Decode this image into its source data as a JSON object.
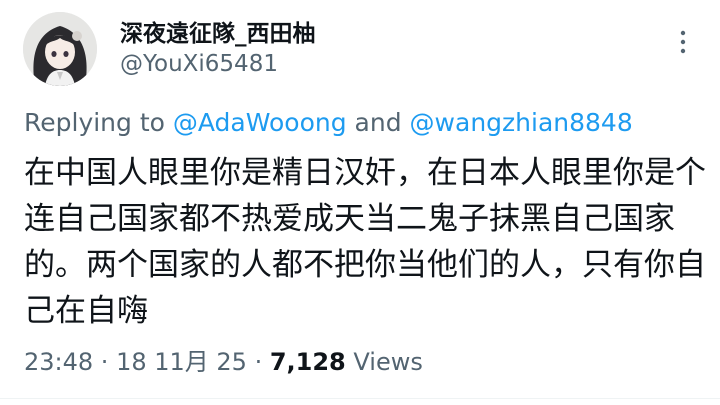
{
  "author": {
    "display_name": "深夜遠征隊_西田柚",
    "handle": "@YouXi65481",
    "avatar_icon": "anime-avatar-icon"
  },
  "more_icon": "more-vertical-icon",
  "reply": {
    "prefix": "Replying to ",
    "mention_1": "@AdaWooong",
    "joiner": " and ",
    "mention_2": "@wangzhian8848"
  },
  "body": "在中国人眼里你是精日汉奸，在日本人眼里你是个连自己国家都不热爱成天当二鬼子抹黑自己国家的。两个国家的人都不把你当他们的人，只有你自己在自嗨",
  "meta": {
    "time": "23:48",
    "sep_1": " · ",
    "date": "18 11月 25",
    "sep_2": " · ",
    "views": "7,128",
    "views_label": " Views"
  },
  "colors": {
    "text": "#0f1419",
    "secondary": "#536471",
    "link": "#1d9bf0"
  }
}
